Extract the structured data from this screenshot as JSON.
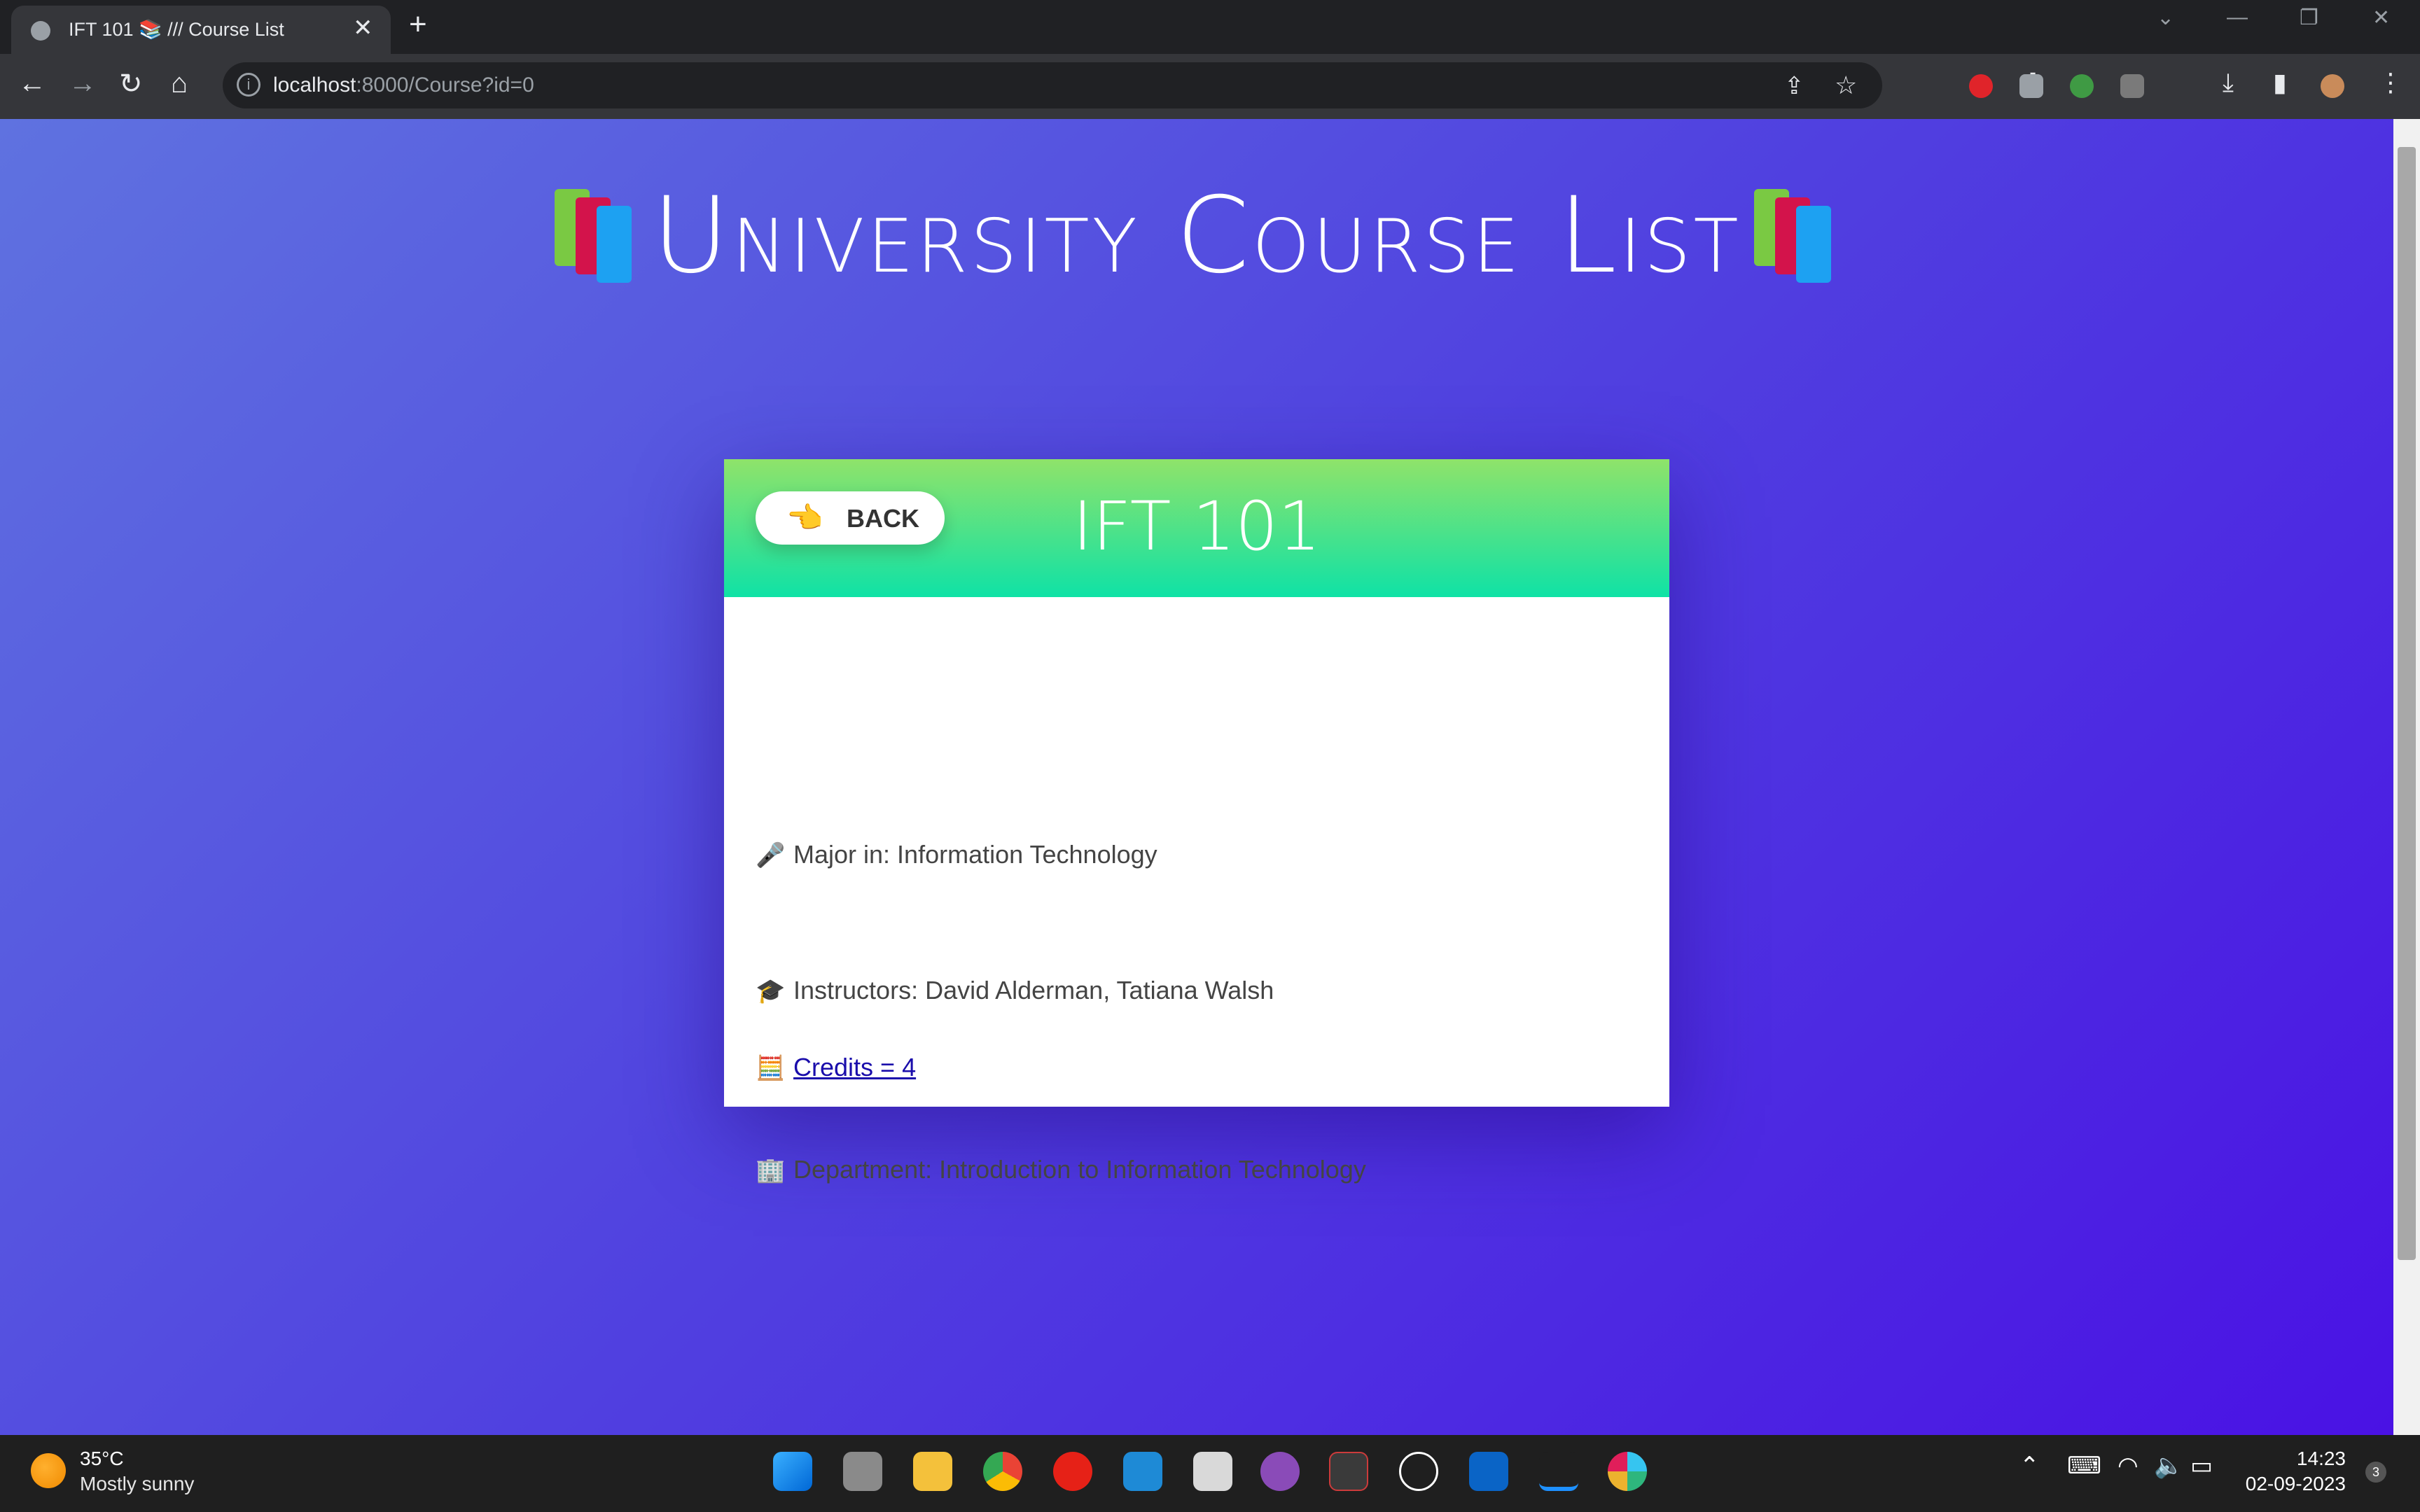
{
  "browser": {
    "tab_title": "IFT 101 📚 /// Course List",
    "tab_close": "✕",
    "new_tab": "+",
    "url_host": "localhost",
    "url_rest": ":8000/Course?id=0"
  },
  "page": {
    "heading": "University Course List",
    "heading_emoji": "📚",
    "back_label": "BACK",
    "back_icon": "👈",
    "course_code": "IFT 101",
    "major_icon": "🎤",
    "major_text": "Major in: Information Technology",
    "instructors_icon": "🎓",
    "instructors_text": "Instructors: David Alderman, Tatiana Walsh",
    "credits_icon": "🧮",
    "credits_text": "Credits = 4",
    "department_icon": "🏢",
    "department_text": "Department: Introduction to Information Technology"
  },
  "taskbar": {
    "weather_temp": "35°C",
    "weather_desc": "Mostly sunny",
    "time": "14:23",
    "date": "02-09-2023",
    "notif_count": "3"
  },
  "colors": {
    "gradient_start": "#5f72e0",
    "gradient_end": "#4a12e4",
    "card_head_top": "#8fe36a",
    "card_head_bottom": "#0fe2a6",
    "link": "#1a0dab"
  }
}
